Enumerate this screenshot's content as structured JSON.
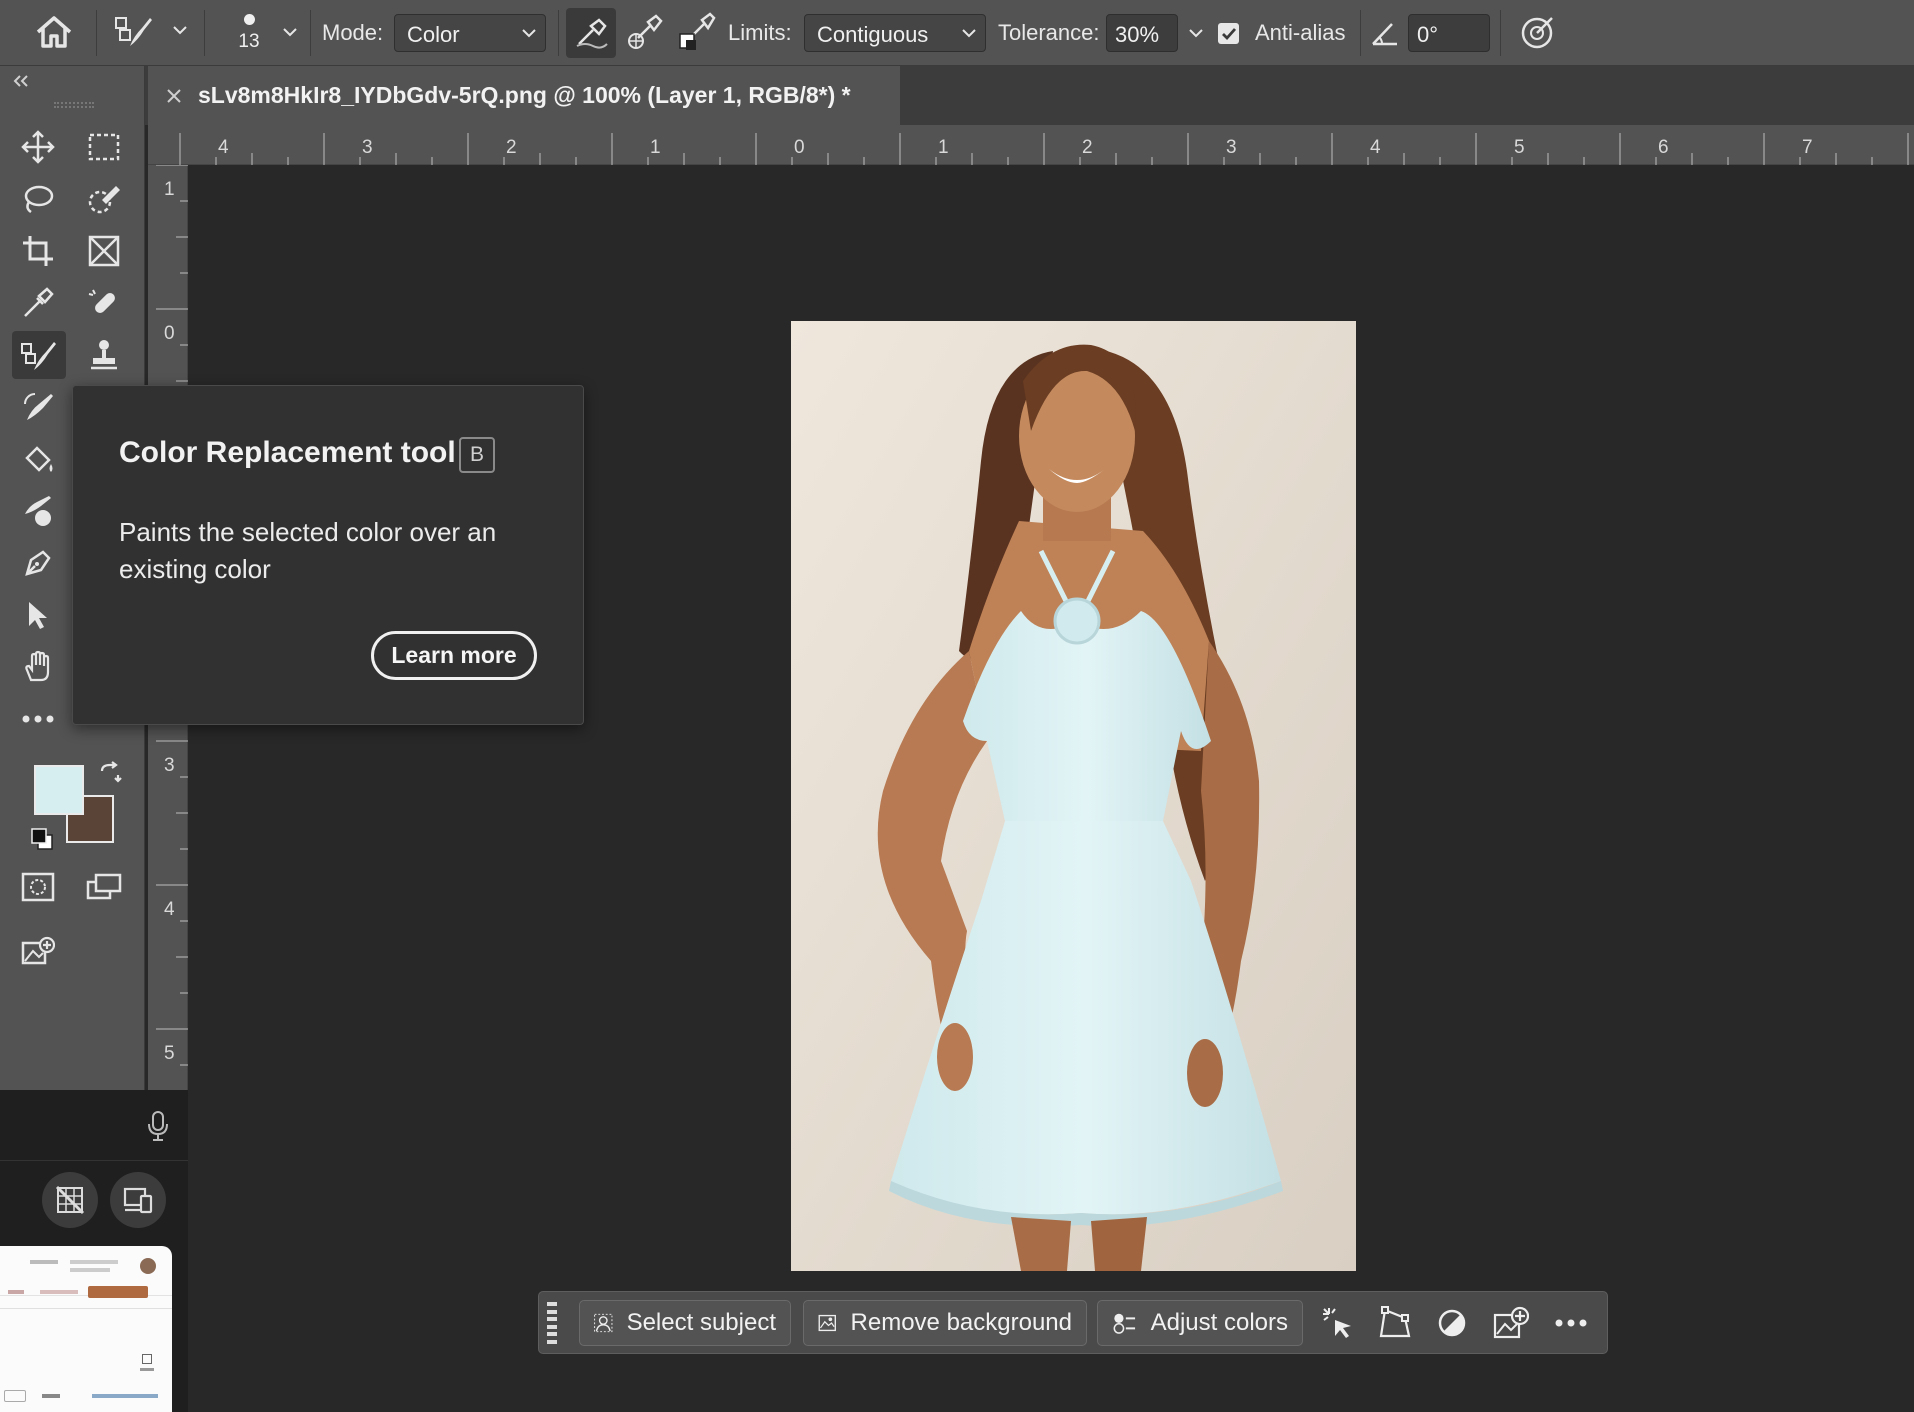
{
  "options_bar": {
    "brush_size": "13",
    "mode_label": "Mode:",
    "mode_value": "Color",
    "limits_label": "Limits:",
    "limits_value": "Contiguous",
    "tolerance_label": "Tolerance:",
    "tolerance_value": "30%",
    "antialias_label": "Anti-alias",
    "antialias_checked": true,
    "angle_value": "0°"
  },
  "document_tab": {
    "title": "sLv8m8HkIr8_IYDbGdv-5rQ.png @ 100% (Layer 1, RGB/8*) *"
  },
  "rulers": {
    "horizontal": [
      "4",
      "3",
      "2",
      "1",
      "0",
      "1",
      "2",
      "3",
      "4",
      "5",
      "6",
      "7"
    ],
    "vertical": [
      "1",
      "0",
      "3",
      "4",
      "5"
    ]
  },
  "tooltip": {
    "title": "Color Replacement tool",
    "shortcut": "B",
    "description": "Paints the selected color over an existing color",
    "learn_more": "Learn more"
  },
  "colors": {
    "foreground": "#d6eef0",
    "background": "#5a4438",
    "panel": "#535353",
    "canvas_bg": "#282828"
  },
  "taskbar": {
    "select_subject": "Select subject",
    "remove_background": "Remove background",
    "adjust_colors": "Adjust colors"
  }
}
